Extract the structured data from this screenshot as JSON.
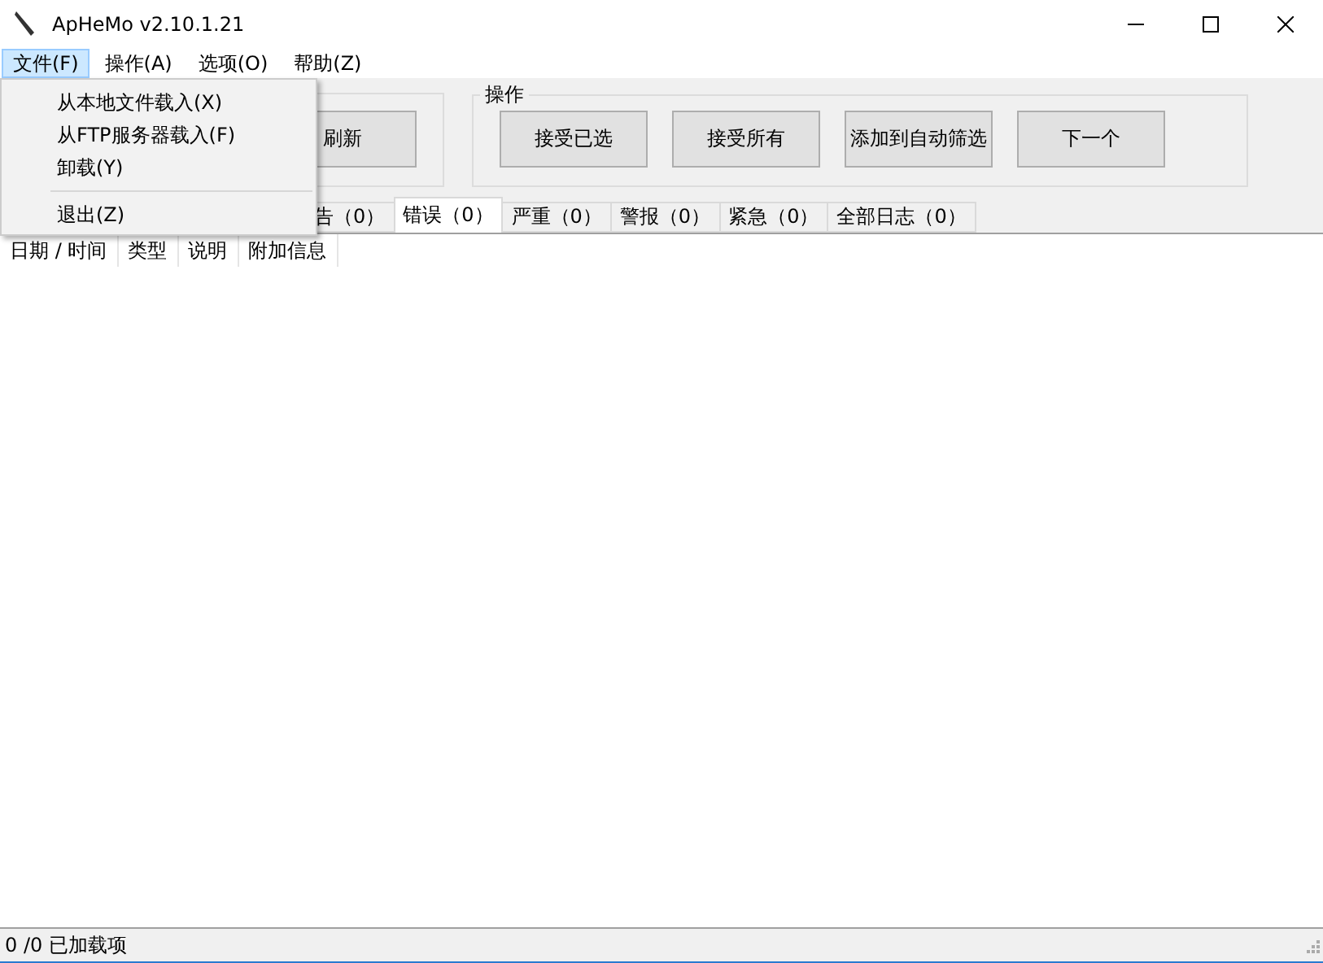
{
  "window": {
    "title": "ApHeMo v2.10.1.21"
  },
  "menu_bar": [
    {
      "label": "文件(F)",
      "selected": true
    },
    {
      "label": "操作(A)",
      "selected": false
    },
    {
      "label": "选项(O)",
      "selected": false
    },
    {
      "label": "帮助(Z)",
      "selected": false
    }
  ],
  "file_menu": [
    {
      "kind": "item",
      "label": "从本地文件载入(X)"
    },
    {
      "kind": "item",
      "label": "从FTP服务器载入(F)"
    },
    {
      "kind": "item",
      "label": "卸载(Y)"
    },
    {
      "kind": "separator"
    },
    {
      "kind": "item",
      "label": "退出(Z)"
    }
  ],
  "left_group": {
    "buttons": [
      "刷新"
    ]
  },
  "actions_group": {
    "title": "操作",
    "buttons": [
      "接受已选",
      "接受所有",
      "添加到自动筛选",
      "下一个"
    ]
  },
  "tabs": [
    {
      "label": "告（0）",
      "selected": false
    },
    {
      "label": "错误（0）",
      "selected": true
    },
    {
      "label": "严重（0）",
      "selected": false
    },
    {
      "label": "警报（0）",
      "selected": false
    },
    {
      "label": "紧急（0）",
      "selected": false
    },
    {
      "label": "全部日志（0）",
      "selected": false
    }
  ],
  "table": {
    "columns": [
      "日期 / 时间",
      "类型",
      "说明",
      "附加信息"
    ]
  },
  "status_bar": "0 /0 已加载项"
}
